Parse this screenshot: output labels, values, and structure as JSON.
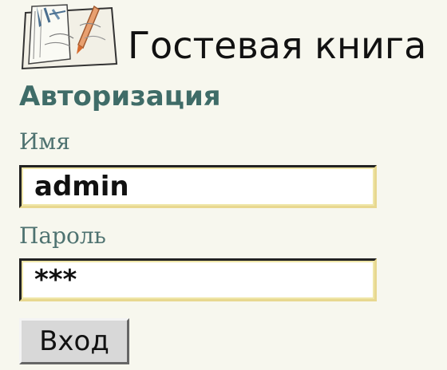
{
  "header": {
    "logo_icon": "guestbook-notebook-icon",
    "title": "Гостевая книга"
  },
  "login_form": {
    "heading": "Авторизация",
    "name_label": "Имя",
    "name_value": "admin",
    "password_label": "Пароль",
    "password_value": "***",
    "submit_label": "Вход"
  },
  "colors": {
    "background": "#f7f7ee",
    "heading": "#3f6c68",
    "label": "#4e7270",
    "field_border_highlight": "#e8d890",
    "button_face": "#d8d8d8"
  }
}
